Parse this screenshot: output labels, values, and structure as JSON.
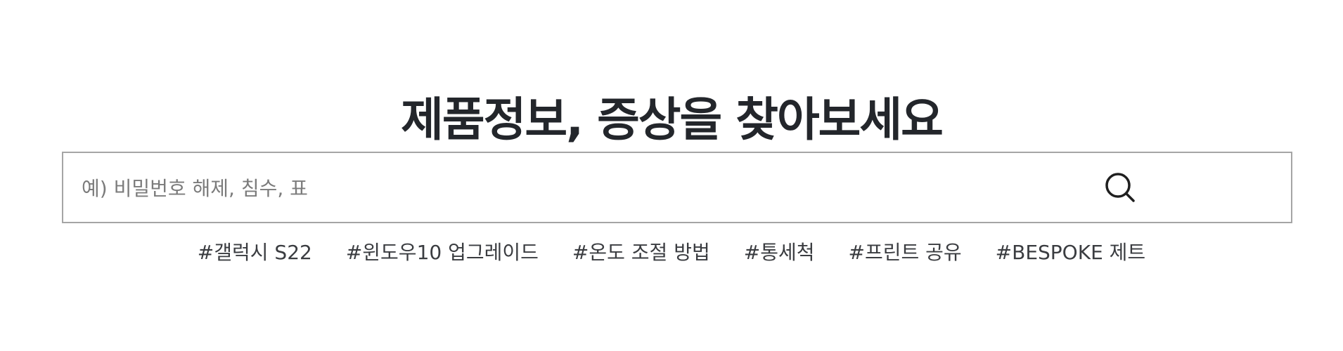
{
  "title": "제품정보, 증상을 찾아보세요",
  "search": {
    "placeholder": "예) 비밀번호 해제, 침수, 표",
    "icon": "search-icon"
  },
  "tags": [
    "#갤럭시 S22",
    "#윈도우10 업그레이드",
    "#온도 조절 방법",
    "#통세척",
    "#프린트 공유",
    "#BESPOKE 제트"
  ],
  "colors": {
    "title": "#23262b",
    "border": "#a5a5a5",
    "placeholder": "#7b7b7b",
    "tag": "#3a3c40"
  }
}
